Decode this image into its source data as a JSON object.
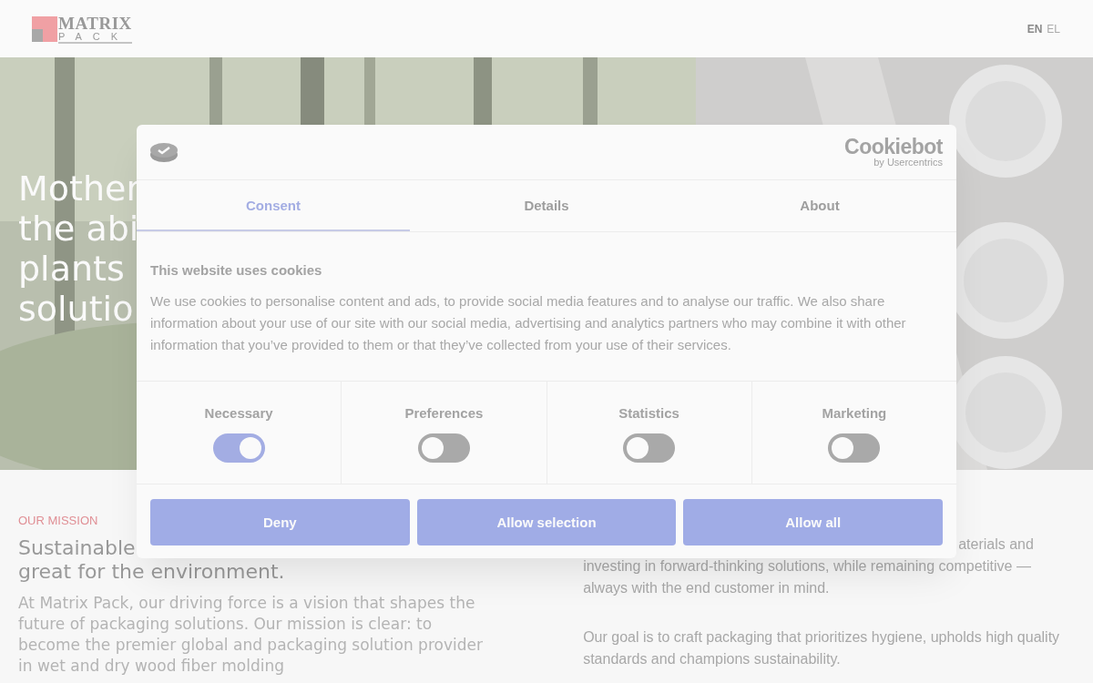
{
  "header": {
    "logo": {
      "word_1": "MATRIX",
      "word_2": "PACK"
    },
    "languages": [
      {
        "label": "EN",
        "selected": true
      },
      {
        "label": "EL",
        "selected": false
      }
    ]
  },
  "hero": {
    "lines": [
      "Mother",
      "the abi",
      "plants",
      "solutio"
    ]
  },
  "mission": {
    "eyebrow": "OUR MISSION",
    "heading_lines": [
      "Sustainable",
      "great for the environment."
    ],
    "paragraph": "At Matrix Pack, our driving force is a vision that shapes the future of packaging solutions. Our mission is clear: to become the premier global and packaging solution provider in wet and dry wood fiber molding"
  },
  "right_column": {
    "paragraph_1_lines": [
      "aterials and",
      "investing in forward-thinking solutions, while remaining competitive —",
      "always with the end customer in mind."
    ],
    "paragraph_2": "Our goal is to craft packaging that prioritizes hygiene, upholds high quality standards and champions sustainability."
  },
  "cookie_dialog": {
    "brand": "Cookiebot",
    "brand_sub": "by Usercentrics",
    "tabs": [
      {
        "label": "Consent",
        "selected": true
      },
      {
        "label": "Details",
        "selected": false
      },
      {
        "label": "About",
        "selected": false
      }
    ],
    "title": "This website uses cookies",
    "text": "We use cookies to personalise content and ads, to provide social media features and to analyse our traffic. We also share information about your use of our site with our social media, advertising and analytics partners who may combine it with other information that you’ve provided to them or that they’ve collected from your use of their services.",
    "categories": [
      {
        "label": "Necessary",
        "checked": true
      },
      {
        "label": "Preferences",
        "checked": false
      },
      {
        "label": "Statistics",
        "checked": false
      },
      {
        "label": "Marketing",
        "checked": false
      }
    ],
    "buttons": [
      "Deny",
      "Allow selection",
      "Allow all"
    ]
  }
}
